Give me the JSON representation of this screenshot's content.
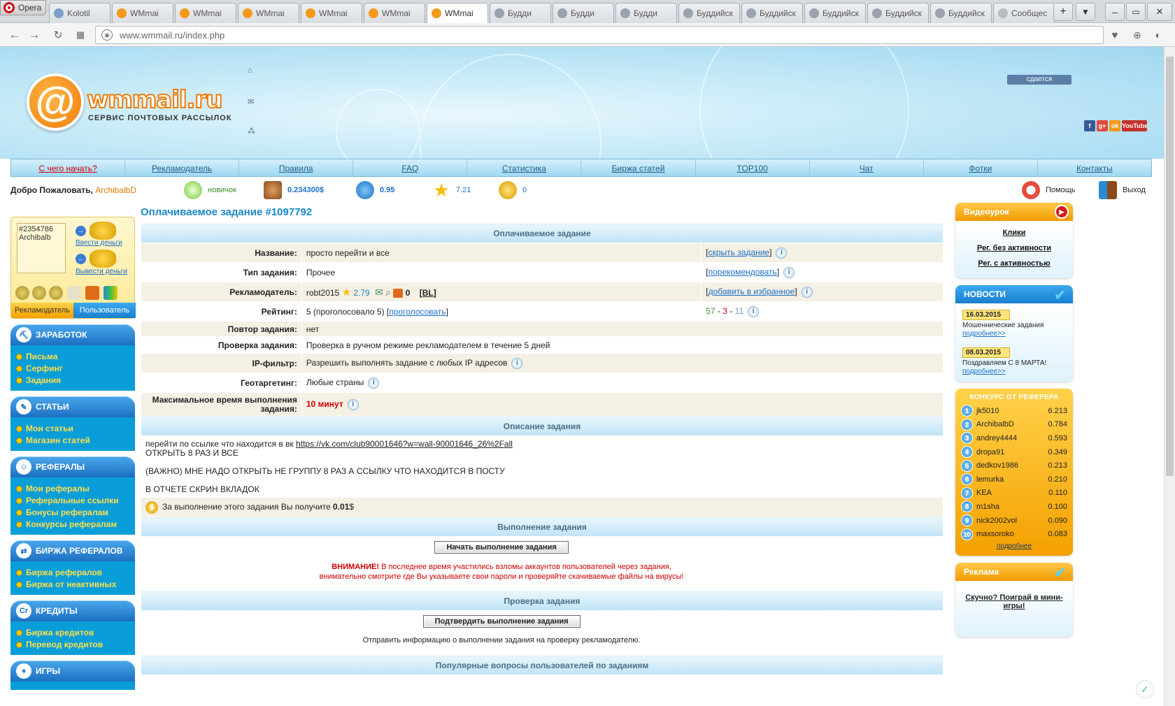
{
  "browser": {
    "menu_label": "Opera",
    "tabs": [
      {
        "label": "Kolotil",
        "color": "#7aa0c8",
        "active": false
      },
      {
        "label": "WMmai",
        "color": "#f39a1a",
        "active": false
      },
      {
        "label": "WMmai",
        "color": "#f39a1a",
        "active": false
      },
      {
        "label": "WMmai",
        "color": "#f39a1a",
        "active": false
      },
      {
        "label": "WMmai",
        "color": "#f39a1a",
        "active": false
      },
      {
        "label": "WMmai",
        "color": "#f39a1a",
        "active": false
      },
      {
        "label": "WMmai",
        "color": "#f39a1a",
        "active": true
      },
      {
        "label": "Будди",
        "color": "#9aa2ad",
        "active": false
      },
      {
        "label": "Будди",
        "color": "#9aa2ad",
        "active": false
      },
      {
        "label": "Будди",
        "color": "#9aa2ad",
        "active": false
      },
      {
        "label": "Буддийск",
        "color": "#9aa2ad",
        "active": false
      },
      {
        "label": "Буддийск",
        "color": "#9aa2ad",
        "active": false
      },
      {
        "label": "Буддийск",
        "color": "#9aa2ad",
        "active": false
      },
      {
        "label": "Буддийск",
        "color": "#9aa2ad",
        "active": false
      },
      {
        "label": "Буддийск",
        "color": "#9aa2ad",
        "active": false
      },
      {
        "label": "Сообщес",
        "color": "#bbbbbb",
        "active": false
      }
    ],
    "url": "www.wmmail.ru/index.php"
  },
  "banner": {
    "logo_text": "wmmail.ru",
    "tagline": "СЕРВИС ПОЧТОВЫХ РАССЫЛОК",
    "rent_badge": "сдается",
    "youtube": "YouTube"
  },
  "menu": [
    "С чего начать?",
    "Рекламодатель",
    "Правила",
    "FAQ",
    "Статистика",
    "Биржа статей",
    "TOP100",
    "Чат",
    "Фотки",
    "Контакты"
  ],
  "userbar": {
    "welcome": "Добро Пожаловать,",
    "username": "ArchibalbD",
    "status": "новичок",
    "balance": "0.234300$",
    "credits": "0.95",
    "rating": "7.21",
    "coins": "0",
    "help": "Помощь",
    "logout": "Выход"
  },
  "profile": {
    "avatar_alt": "#2354786 Archibalb",
    "deposit": "Ввести деньги",
    "withdraw": "Вывести деньги",
    "tab_advertiser": "Рекламодатель",
    "tab_user": "Пользователь"
  },
  "nav": [
    {
      "title": "ЗАРАБОТОК",
      "items": [
        "Письма",
        "Серфинг",
        "Задания"
      ]
    },
    {
      "title": "СТАТЬИ",
      "items": [
        "Мои статьи",
        "Магазин статей"
      ]
    },
    {
      "title": "РЕФЕРАЛЫ",
      "items": [
        "Мои рефералы",
        "Реферальные ссылки",
        "Бонусы рефералам",
        "Конкурсы рефералам"
      ]
    },
    {
      "title": "БИРЖА РЕФЕРАЛОВ",
      "items": [
        "Биржа рефералов",
        "Биржа от неактивных"
      ]
    },
    {
      "title": "КРЕДИТЫ",
      "items": [
        "Биржа кредитов",
        "Перевод кредитов"
      ]
    },
    {
      "title": "ИГРЫ",
      "items": []
    }
  ],
  "task": {
    "title": "Оплачиваемое задание #1097792",
    "section_paid": "Оплачиваемое задание",
    "rows": {
      "name_label": "Название:",
      "name_value": "просто перейти и все",
      "hide_link": "скрыть задание",
      "type_label": "Тип задания:",
      "type_value": "Прочее",
      "recommend_link": "порекомендовать",
      "advertiser_label": "Рекламодатель:",
      "advertiser_value": "robt2015",
      "advertiser_rating": "2.79",
      "advertiser_count": "0",
      "bl": "BL",
      "favorite_link": "добавить в избранное",
      "rating_label": "Рейтинг:",
      "rating_value": "5 (проголосовало 5)",
      "vote_link": "проголосовать",
      "votes_good": "57",
      "votes_bad": "3",
      "votes_neutral": "11",
      "repeat_label": "Повтор задания:",
      "repeat_value": "нет",
      "check_label": "Проверка задания:",
      "check_value": "Проверка в ручном режиме рекламодателем в течение 5 дней",
      "ip_label": "IP-фильтр:",
      "ip_value": "Разрешить выполнять задание с любых IP адресов",
      "geo_label": "Геотаргетинг:",
      "geo_value": "Любые страны",
      "time_label": "Максимальное время выполнения задания:",
      "time_value": "10 минут"
    },
    "section_desc": "Описание задания",
    "desc_line1_prefix": "перейти по ссылке что находится в вк",
    "desc_link": "https://vk.com/club90001646?w=wall-90001646_26%2Fall",
    "desc_line2": "ОТКРЫТЬ 8 РАЗ И ВСЕ",
    "desc_line3": "(ВАЖНО) МНЕ НАДО ОТКРЫТЬ НЕ ГРУППУ 8 РАЗ А ССЫЛКУ ЧТО НАХОДИТСЯ В ПОСТУ",
    "desc_line4": "В ОТЧЕТЕ СКРИН ВКЛАДОК",
    "earn_text": "За выполнение этого задания Вы получите",
    "earn_amount": "0.01",
    "earn_currency": "$",
    "section_exec": "Выполнение задания",
    "start_button": "Начать выполнение задания",
    "warning_bold": "ВНИМАНИЕ!",
    "warning_text": "В последнее время участились взломы аккаунтов пользователей через задания,",
    "warning_text2": "внимательно смотрите где Вы указываете свои пароли и проверяйте скачиваемые файлы на вирусы!",
    "section_verify": "Проверка задания",
    "confirm_button": "Подтвердить выполнение задания",
    "verify_text": "Отправить информацию о выполнении задания на проверку рекламодателю.",
    "section_faq": "Популярные вопросы пользователей по заданиям"
  },
  "right": {
    "video_title": "Видеоурок",
    "video_links": [
      "Клики",
      "Рег. без активности",
      "Рег. с активностью"
    ],
    "news_title": "НОВОСТИ",
    "news": [
      {
        "date": "16.03.2015",
        "text": "Мошеннические задания",
        "more": "подробнее>>"
      },
      {
        "date": "08.03.2015",
        "text": "Поздравляем С 8 МАРТА!",
        "more": "подробнее>>"
      }
    ],
    "contest_title": "КОНКУРС ОТ РЕФЕРЕРА",
    "contest": [
      {
        "n": "1",
        "name": "jk5010",
        "score": "6.213"
      },
      {
        "n": "2",
        "name": "ArchibalbD",
        "score": "0.784"
      },
      {
        "n": "3",
        "name": "andrey4444",
        "score": "0.593"
      },
      {
        "n": "4",
        "name": "dropa91",
        "score": "0.349"
      },
      {
        "n": "5",
        "name": "dedkov1986",
        "score": "0.213"
      },
      {
        "n": "6",
        "name": "lemurka",
        "score": "0.210"
      },
      {
        "n": "7",
        "name": "KEA",
        "score": "0.110"
      },
      {
        "n": "8",
        "name": "m1sha",
        "score": "0.100"
      },
      {
        "n": "9",
        "name": "nick2002vol",
        "score": "0.090"
      },
      {
        "n": "10",
        "name": "maxsoroko",
        "score": "0.083"
      }
    ],
    "contest_more": "подробнее",
    "ad_title": "Реклама",
    "ad_text": "Скучно? Поиграй в мини-игры!"
  }
}
